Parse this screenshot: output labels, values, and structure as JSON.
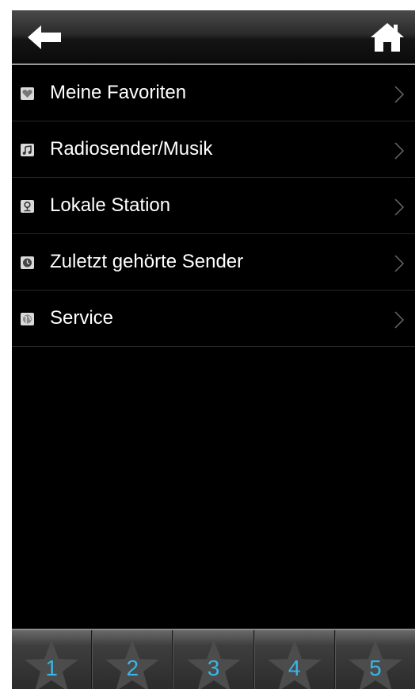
{
  "header": {
    "back_icon": "back-arrow-icon",
    "home_icon": "home-icon"
  },
  "menu": {
    "items": [
      {
        "label": "Meine Favoriten",
        "icon": "heart-icon"
      },
      {
        "label": "Radiosender/Musik",
        "icon": "music-note-icon"
      },
      {
        "label": "Lokale Station",
        "icon": "location-pin-icon"
      },
      {
        "label": "Zuletzt gehörte Sender",
        "icon": "clock-icon"
      },
      {
        "label": "Service",
        "icon": "globe-icon"
      }
    ]
  },
  "presets": {
    "items": [
      {
        "label": "1"
      },
      {
        "label": "2"
      },
      {
        "label": "3"
      },
      {
        "label": "4"
      },
      {
        "label": "5"
      }
    ]
  },
  "colors": {
    "preset_number": "#39b5e6",
    "background": "#000000",
    "text": "#ffffff"
  }
}
